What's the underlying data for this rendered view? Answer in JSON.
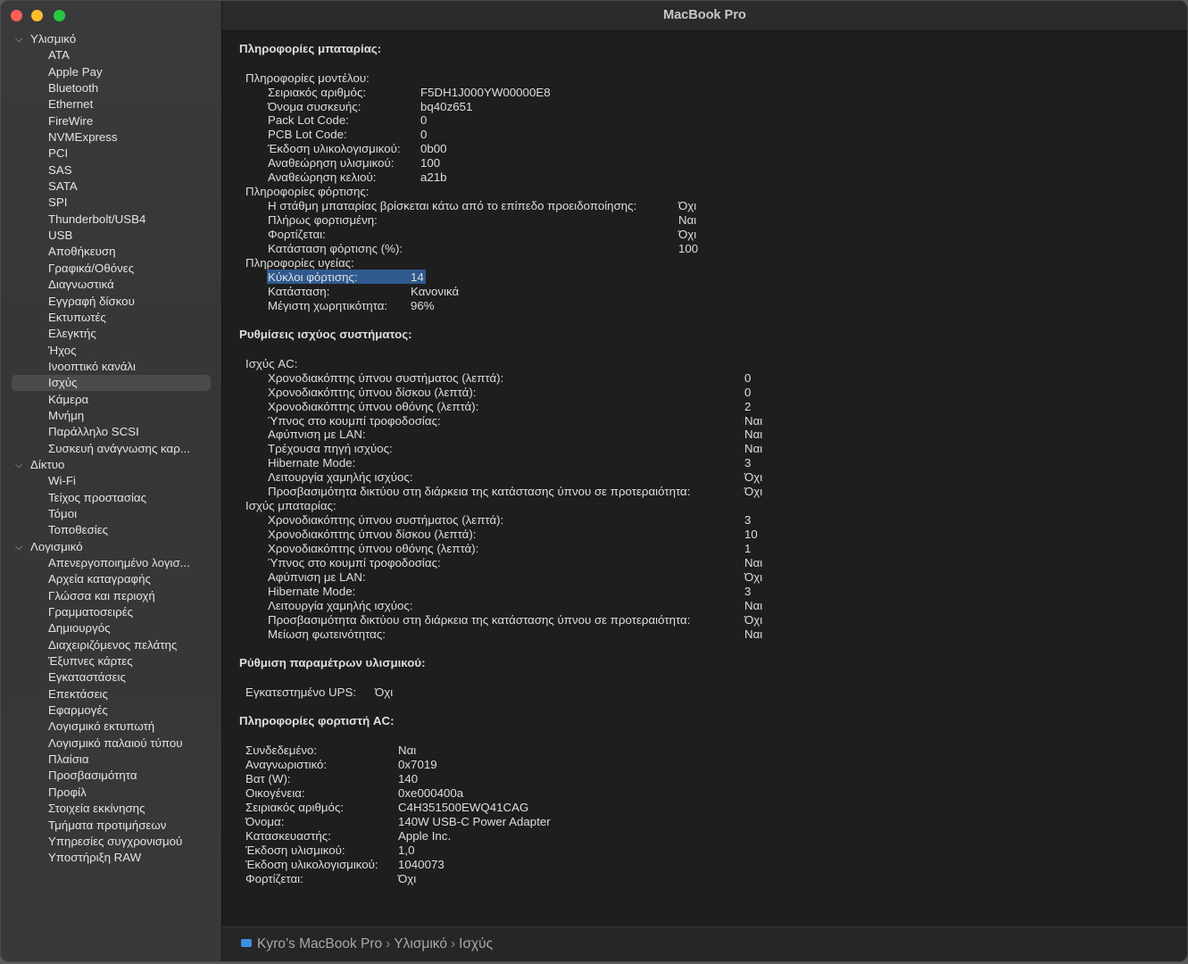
{
  "window": {
    "title": "MacBook Pro"
  },
  "colors": {
    "selection": "#2f5a8f",
    "sidebar_selected": "#4b4b4d",
    "folder_icon": "#3d8fe0"
  },
  "sidebar": {
    "tree": [
      {
        "label": "Υλισμικό",
        "level": 0
      },
      {
        "label": "ATA",
        "level": 1
      },
      {
        "label": "Apple Pay",
        "level": 1
      },
      {
        "label": "Bluetooth",
        "level": 1
      },
      {
        "label": "Ethernet",
        "level": 1
      },
      {
        "label": "FireWire",
        "level": 1
      },
      {
        "label": "NVMExpress",
        "level": 1
      },
      {
        "label": "PCI",
        "level": 1
      },
      {
        "label": "SAS",
        "level": 1
      },
      {
        "label": "SATA",
        "level": 1
      },
      {
        "label": "SPI",
        "level": 1
      },
      {
        "label": "Thunderbolt/USB4",
        "level": 1
      },
      {
        "label": "USB",
        "level": 1
      },
      {
        "label": "Αποθήκευση",
        "level": 1
      },
      {
        "label": "Γραφικά/Οθόνες",
        "level": 1
      },
      {
        "label": "Διαγνωστικά",
        "level": 1
      },
      {
        "label": "Εγγραφή δίσκου",
        "level": 1
      },
      {
        "label": "Εκτυπωτές",
        "level": 1
      },
      {
        "label": "Ελεγκτής",
        "level": 1
      },
      {
        "label": "Ήχος",
        "level": 1
      },
      {
        "label": "Ινοοπτικό κανάλι",
        "level": 1
      },
      {
        "label": "Ισχύς",
        "level": 1,
        "selected": true
      },
      {
        "label": "Κάμερα",
        "level": 1
      },
      {
        "label": "Μνήμη",
        "level": 1
      },
      {
        "label": "Παράλληλο SCSI",
        "level": 1
      },
      {
        "label": "Συσκευή ανάγνωσης καρ...",
        "level": 1
      },
      {
        "label": "Δίκτυο",
        "level": 0
      },
      {
        "label": "Wi-Fi",
        "level": 1
      },
      {
        "label": "Τείχος προστασίας",
        "level": 1
      },
      {
        "label": "Τόμοι",
        "level": 1
      },
      {
        "label": "Τοποθεσίες",
        "level": 1
      },
      {
        "label": "Λογισμικό",
        "level": 0
      },
      {
        "label": "Απενεργοποιημένο λογισ...",
        "level": 1
      },
      {
        "label": "Αρχεία καταγραφής",
        "level": 1
      },
      {
        "label": "Γλώσσα και περιοχή",
        "level": 1
      },
      {
        "label": "Γραμματοσειρές",
        "level": 1
      },
      {
        "label": "Δημιουργός",
        "level": 1
      },
      {
        "label": "Διαχειριζόμενος πελάτης",
        "level": 1
      },
      {
        "label": "Έξυπνες κάρτες",
        "level": 1
      },
      {
        "label": "Εγκαταστάσεις",
        "level": 1
      },
      {
        "label": "Επεκτάσεις",
        "level": 1
      },
      {
        "label": "Εφαρμογές",
        "level": 1
      },
      {
        "label": "Λογισμικό εκτυπωτή",
        "level": 1
      },
      {
        "label": "Λογισμικό παλαιού τύπου",
        "level": 1
      },
      {
        "label": "Πλαίσια",
        "level": 1
      },
      {
        "label": "Προσβασιμότητα",
        "level": 1
      },
      {
        "label": "Προφίλ",
        "level": 1
      },
      {
        "label": "Στοιχεία εκκίνησης",
        "level": 1
      },
      {
        "label": "Τμήματα προτιμήσεων",
        "level": 1
      },
      {
        "label": "Υπηρεσίες συγχρονισμού",
        "level": 1
      },
      {
        "label": "Υποστήριξη RAW",
        "level": 1
      }
    ]
  },
  "content": {
    "sections": [
      {
        "title": "Πληροφορίες μπαταρίας:",
        "groups": [
          {
            "label": "Πληροφορίες μοντέλου:",
            "rows": [
              {
                "key": "Σειριακός αριθμός:",
                "value": "F5DH1J000YW00000E8"
              },
              {
                "key": "Όνομα συσκευής:",
                "value": "bq40z651"
              },
              {
                "key": "Pack Lot Code:",
                "value": "0"
              },
              {
                "key": "PCB Lot Code:",
                "value": "0"
              },
              {
                "key": "Έκδοση υλικολογισμικού:",
                "value": "0b00"
              },
              {
                "key": "Αναθεώρηση υλισμικού:",
                "value": "100"
              },
              {
                "key": "Αναθεώρηση κελιού:",
                "value": "a21b"
              }
            ]
          },
          {
            "label": "Πληροφορίες φόρτισης:",
            "rows": [
              {
                "key": "Η στάθμη μπαταρίας βρίσκεται κάτω από το επίπεδο προειδοποίησης:",
                "value": "Όχι"
              },
              {
                "key": "Πλήρως φορτισμένη:",
                "value": "Ναι"
              },
              {
                "key": "Φορτίζεται:",
                "value": "Όχι"
              },
              {
                "key": "Κατάσταση φόρτισης (%):",
                "value": "100"
              }
            ]
          },
          {
            "label": "Πληροφορίες υγείας:",
            "rows": [
              {
                "key": "Κύκλοι φόρτισης:",
                "value": "14",
                "selected": true
              },
              {
                "key": "Κατάσταση:",
                "value": "Κανονικά"
              },
              {
                "key": "Μέγιστη χωρητικότητα:",
                "value": "96%"
              }
            ]
          }
        ]
      },
      {
        "title": "Ρυθμίσεις ισχύος συστήματος:",
        "groups": [
          {
            "label": "Ισχύς AC:",
            "rows": [
              {
                "key": "Χρονοδιακόπτης ύπνου συστήματος (λεπτά):",
                "value": "0"
              },
              {
                "key": "Χρονοδιακόπτης ύπνου δίσκου (λεπτά):",
                "value": "0"
              },
              {
                "key": "Χρονοδιακόπτης ύπνου οθόνης (λεπτά):",
                "value": "2"
              },
              {
                "key": "Ύπνος στο κουμπί τροφοδοσίας:",
                "value": "Ναι"
              },
              {
                "key": "Αφύπνιση με LAN:",
                "value": "Ναι"
              },
              {
                "key": "Τρέχουσα πηγή ισχύος:",
                "value": "Ναι"
              },
              {
                "key": "Hibernate Mode:",
                "value": "3"
              },
              {
                "key": "Λειτουργία χαμηλής ισχύος:",
                "value": "Όχι"
              },
              {
                "key": "Προσβασιμότητα δικτύου στη διάρκεια της κατάστασης ύπνου σε προτεραιότητα:",
                "value": "Όχι"
              }
            ]
          },
          {
            "label": "Ισχύς μπαταρίας:",
            "rows": [
              {
                "key": "Χρονοδιακόπτης ύπνου συστήματος (λεπτά):",
                "value": "3"
              },
              {
                "key": "Χρονοδιακόπτης ύπνου δίσκου (λεπτά):",
                "value": "10"
              },
              {
                "key": "Χρονοδιακόπτης ύπνου οθόνης (λεπτά):",
                "value": "1"
              },
              {
                "key": "Ύπνος στο κουμπί τροφοδοσίας:",
                "value": "Ναι"
              },
              {
                "key": "Αφύπνιση με LAN:",
                "value": "Όχι"
              },
              {
                "key": "Hibernate Mode:",
                "value": "3"
              },
              {
                "key": "Λειτουργία χαμηλής ισχύος:",
                "value": "Ναι"
              },
              {
                "key": "Προσβασιμότητα δικτύου στη διάρκεια της κατάστασης ύπνου σε προτεραιότητα:",
                "value": "Όχι"
              },
              {
                "key": "Μείωση φωτεινότητας:",
                "value": "Ναι"
              }
            ]
          }
        ]
      },
      {
        "title": "Ρύθμιση παραμέτρων υλισμικού:",
        "top_rows": [
          {
            "key": "Εγκατεστημένο UPS:",
            "value": "Όχι"
          }
        ]
      },
      {
        "title": "Πληροφορίες φορτιστή AC:",
        "top_rows": [
          {
            "key": "Συνδεδεμένο:",
            "value": "Ναι"
          },
          {
            "key": "Αναγνωριστικό:",
            "value": "0x7019"
          },
          {
            "key": "Βατ (W):",
            "value": "140"
          },
          {
            "key": "Οικογένεια:",
            "value": "0xe000400a"
          },
          {
            "key": "Σειριακός αριθμός:",
            "value": "C4H351500EWQ41CAG"
          },
          {
            "key": "Όνομα:",
            "value": "140W USB-C Power Adapter"
          },
          {
            "key": "Κατασκευαστής:",
            "value": "Apple Inc."
          },
          {
            "key": "Έκδοση υλισμικού:",
            "value": "1,0"
          },
          {
            "key": "Έκδοση υλικολογισμικού:",
            "value": "1040073"
          },
          {
            "key": "Φορτίζεται:",
            "value": "Όχι"
          }
        ]
      }
    ]
  },
  "breadcrumb": {
    "items": [
      "Kyro’s MacBook Pro",
      "Υλισμικό",
      "Ισχύς"
    ],
    "separator": "›"
  }
}
